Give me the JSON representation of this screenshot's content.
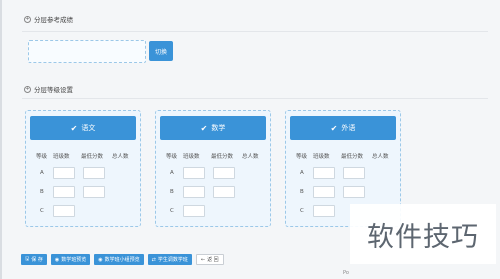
{
  "sections": {
    "reference_scores": "分层参考成绩",
    "level_settings": "分层等级设置"
  },
  "switch_button": "切换",
  "panel_headers": {
    "level": "等级",
    "class_count": "班级数",
    "min_score": "最低分数",
    "total": "总人数"
  },
  "levels": [
    "A",
    "B",
    "C"
  ],
  "subjects": [
    {
      "name": "语文"
    },
    {
      "name": "数学"
    },
    {
      "name": "外语"
    }
  ],
  "toolbar": {
    "save": "保 存",
    "preview_class": "数学班预览",
    "preview_group": "数学班小组预览",
    "student_adjust": "学生调数学班",
    "back": "返 回"
  },
  "watermark": "软件技巧",
  "footer": "Po"
}
